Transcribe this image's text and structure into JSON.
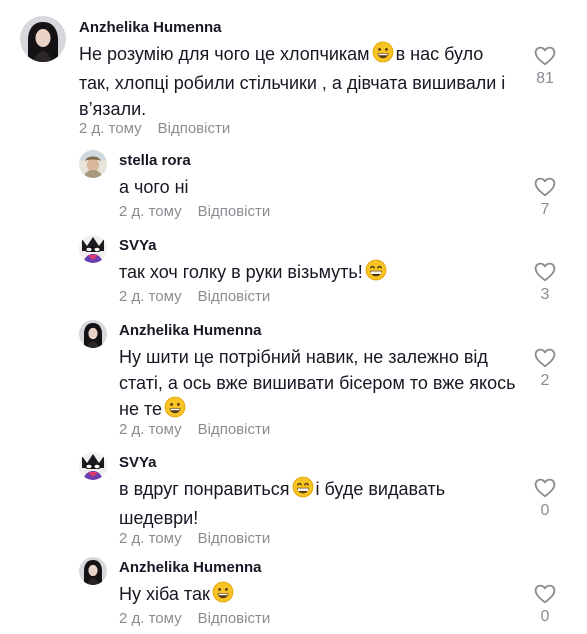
{
  "comments": [
    {
      "username": "Anzhelika Humenna",
      "text": "Не розумію для чого це хлопчикам",
      "emoji": "grinning-face",
      "text_after": "в нас було так, хлопці робили стільчики , а дівчата вишивали і в’язали.",
      "date": "2 д. тому",
      "reply_label": "Відповісти",
      "likes": "81",
      "avatar": "woman-dark-hair-avatar"
    },
    {
      "username": "stella rora",
      "text": "а чого ні",
      "date": "2 д. тому",
      "reply_label": "Відповісти",
      "likes": "7",
      "avatar": "person-light-photo-avatar"
    },
    {
      "username": "SVYa",
      "text": "так хоч голку в руки візьмуть!",
      "emoji": "beaming-face",
      "date": "2 д. тому",
      "reply_label": "Відповісти",
      "likes": "3",
      "avatar": "anime-character-avatar"
    },
    {
      "username": "Anzhelika Humenna",
      "text": "Ну шити це потрібний навик, не залежно від статі, а ось вже вишивати бісером то вже якось не те",
      "emoji": "grinning-face",
      "date": "2 д. тому",
      "reply_label": "Відповісти",
      "likes": "2",
      "avatar": "woman-dark-hair-avatar"
    },
    {
      "username": "SVYa",
      "text": "в вдруг понравиться",
      "emoji": "beaming-face",
      "text_after": "і буде видавать шедеври!",
      "date": "2 д. тому",
      "reply_label": "Відповісти",
      "likes": "0",
      "avatar": "anime-character-avatar"
    },
    {
      "username": "Anzhelika Humenna",
      "text": "Ну хіба так",
      "emoji": "grinning-face",
      "date": "2 д. тому",
      "reply_label": "Відповісти",
      "likes": "0",
      "avatar": "woman-dark-hair-avatar"
    }
  ],
  "colors": {
    "text": "#161823",
    "secondary": "rgba(22,24,35,0.5)",
    "heart_outline": "#8a8b91",
    "emoji_yellow": "#f7c325"
  }
}
